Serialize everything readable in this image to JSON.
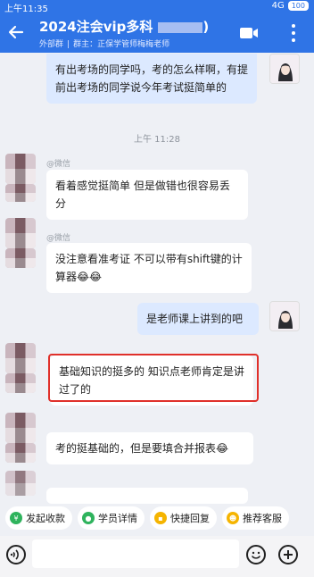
{
  "status_bar": {
    "time": "上午11:35",
    "signal": "4G",
    "battery": "100"
  },
  "header": {
    "title": "2024注会vip多科",
    "title_suffix": ")",
    "tag": "外部群",
    "group_owner": "群主：正保学管师梅梅老师"
  },
  "messages": [
    {
      "side": "mine",
      "text": "有出考场的同学吗，考的怎么样啊，有提前出考场的同学说今年考试挺简单的"
    },
    {
      "side": "timestamp",
      "text": "上午 11:28"
    },
    {
      "side": "other",
      "sender": "@微信",
      "text": "看着感觉挺简单 但是做错也很容易丢分"
    },
    {
      "side": "other",
      "sender": "@微信",
      "text": "没注意看准考证 不可以带有shift键的计算器😂😂"
    },
    {
      "side": "mine",
      "text": "是老师课上讲到的吧"
    },
    {
      "side": "other",
      "text": "基础知识的挺多的 知识点老师肯定是讲过了的",
      "highlighted": true
    },
    {
      "side": "other",
      "text": "考的挺基础的，但是要填合并报表😂"
    }
  ],
  "quick_actions": [
    {
      "label": "发起收款",
      "icon": "payment-icon",
      "color": "#2fb35d"
    },
    {
      "label": "学员详情",
      "icon": "user-detail-icon",
      "color": "#2fb35d"
    },
    {
      "label": "快捷回复",
      "icon": "quick-reply-icon",
      "color": "#f5b400"
    },
    {
      "label": "推荐客服",
      "icon": "recommend-service-icon",
      "color": "#f5b400"
    }
  ],
  "colors": {
    "header": "#2f74e6",
    "highlight": "#e0302a",
    "mine_bubble": "#dce9ff"
  }
}
